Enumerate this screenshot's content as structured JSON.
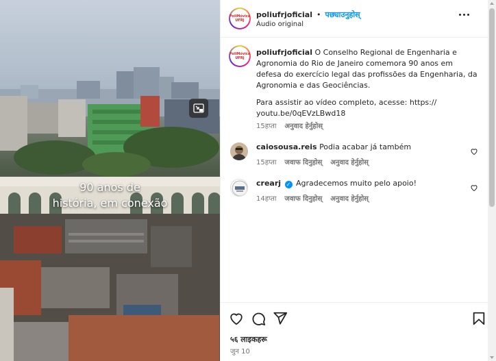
{
  "video": {
    "caption_line1": "90 anos de",
    "caption_line2": "história, em conexão",
    "control_icon": "picture-in-picture-icon"
  },
  "header": {
    "avatar_text": "PoliMóvica UFRJ",
    "username": "poliufrjoficial",
    "separator": "•",
    "follow_label": "पछ्याउनुहोस्",
    "audio": "Áudio original",
    "more_icon": "more-horizontal-icon"
  },
  "caption": {
    "username": "poliufrjoficial",
    "text": "O Conselho Regional de Engenharia e Agronomia do Rio de Janeiro comemora 90 anos em defesa do exercício legal das profissões da Engenharia, da Agronomia e das Geociências.",
    "link_text": "Para assistir ao vídeo completo, acesse: https:// youtu.be/0qEVzLBwd18",
    "time": "15हप्ता",
    "translate": "अनुवाद हेर्नुहोस्"
  },
  "comments": [
    {
      "username": "caiosousa.reis",
      "text": "Podia acabar já também",
      "time": "15हप्ता",
      "reply": "जवाफ दिनुहोस्",
      "translate": "अनुवाद हेर्नुहोस्"
    },
    {
      "username": "crearj",
      "verified": true,
      "text": "Agradecemos muito pelo apoio!",
      "time": "14हप्ता",
      "reply": "जवाफ दिनुहोस्",
      "translate": "अनुवाद हेर्नुहोस्"
    }
  ],
  "actions": {
    "like_icon": "heart-icon",
    "comment_icon": "comment-icon",
    "share_icon": "share-icon",
    "save_icon": "bookmark-icon",
    "likes": "५६ लाइकहरू",
    "date": "जुन 10"
  },
  "colors": {
    "accent": "#0095f6",
    "text": "#262626",
    "muted": "#737373",
    "border": "#efefef"
  }
}
